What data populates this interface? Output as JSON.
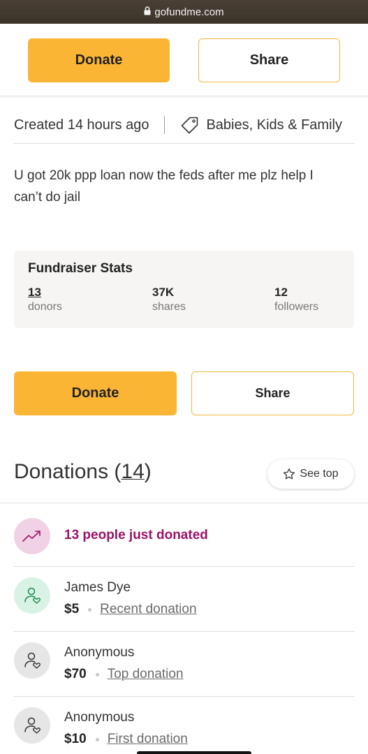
{
  "browser": {
    "url": "gofundme.com"
  },
  "sticky_bar": {
    "donate_label": "Donate",
    "share_label": "Share"
  },
  "meta": {
    "created": "Created 14 hours ago",
    "category": "Babies, Kids & Family"
  },
  "story": {
    "text": "U got 20k ppp loan now the feds after me plz help I can’t do jail"
  },
  "stats": {
    "title": "Fundraiser Stats",
    "donors": {
      "value": "13",
      "label": "donors"
    },
    "shares": {
      "value": "37K",
      "label": "shares"
    },
    "followers": {
      "value": "12",
      "label": "followers"
    }
  },
  "actions": {
    "donate_label": "Donate",
    "share_label": "Share"
  },
  "donations": {
    "title": "Donations (",
    "count": "14",
    "close": ")",
    "see_top_label": "See top",
    "trend_text": "13 people just donated",
    "items": [
      {
        "name": "James Dye",
        "amount": "$5",
        "kind": "Recent donation"
      },
      {
        "name": "Anonymous",
        "amount": "$70",
        "kind": "Top donation"
      },
      {
        "name": "Anonymous",
        "amount": "$10",
        "kind": "First donation"
      }
    ]
  },
  "colors": {
    "primary": "#fbb534",
    "trend": "#9b1268",
    "recent_avatar": "#d9f2e6",
    "trend_avatar": "#f1d1e6"
  }
}
